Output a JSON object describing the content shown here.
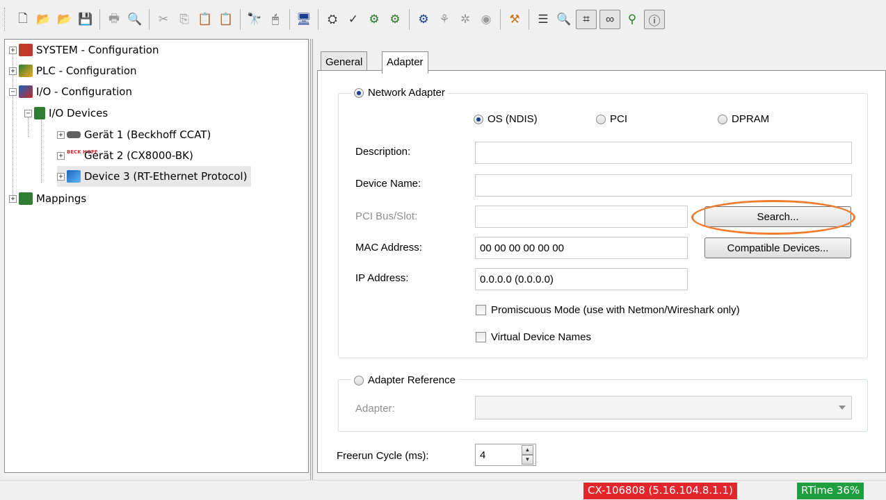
{
  "toolbar": {
    "buttons": [
      "new-file",
      "open-file",
      "open-project",
      "save",
      "print",
      "print-preview",
      "cut",
      "copy",
      "paste",
      "paste-with-links",
      "find",
      "mouse",
      "screen",
      "activate-config",
      "check-config",
      "build",
      "run-mode",
      "config-mode",
      "scan",
      "watch",
      "target",
      "toggle-free-run",
      "find-small",
      "zoom",
      "show-online",
      "toggle-monitoring",
      "network"
    ],
    "colors": {
      "blue": "#1a3d8f",
      "green": "#2a7a2a",
      "gray": "#9a9a9a"
    }
  },
  "tree": {
    "items": [
      {
        "label": "SYSTEM - Configuration",
        "icon": "system-config-icon",
        "color": "#c0392b"
      },
      {
        "label": "PLC - Configuration",
        "icon": "plc-config-icon",
        "color": "#2e7d32"
      },
      {
        "label": "I/O - Configuration",
        "icon": "io-config-icon",
        "color": "#1565c0"
      },
      {
        "label": "I/O Devices",
        "icon": "io-devices-icon",
        "color": "#2e7d32"
      },
      {
        "label": "Gerät 1 (Beckhoff CCAT)",
        "icon": "ccat-card-icon",
        "color": "#555555"
      },
      {
        "label": "Gerät 2 (CX8000-BK)",
        "icon": "beckhoff-logo-icon",
        "color": "#d32f2f",
        "icon_text": "BECK HOFF"
      },
      {
        "label": "Device 3 (RT-Ethernet Protocol)",
        "icon": "network-device-icon",
        "color": "#1565c0"
      },
      {
        "label": "Mappings",
        "icon": "mappings-icon",
        "color": "#2e7d32"
      }
    ]
  },
  "tabs": [
    {
      "label": "General",
      "active": false
    },
    {
      "label": "Adapter",
      "active": true
    }
  ],
  "adapter": {
    "network_adapter_label": "Network Adapter",
    "network_adapter_selected": true,
    "mode_options": [
      {
        "label": "OS (NDIS)",
        "selected": true
      },
      {
        "label": "PCI",
        "selected": false
      },
      {
        "label": "DPRAM",
        "selected": false
      }
    ],
    "description_label": "Description:",
    "description_value": "",
    "device_name_label": "Device Name:",
    "device_name_value": "",
    "pci_bus_label": "PCI Bus/Slot:",
    "pci_bus_value": "",
    "search_button": "Search...",
    "mac_label": "MAC Address:",
    "mac_value": "00 00 00 00 00 00",
    "compatible_button": "Compatible Devices...",
    "ip_label": "IP Address:",
    "ip_value": "0.0.0.0 (0.0.0.0)",
    "promiscuous_label": "Promiscuous Mode (use with Netmon/Wireshark only)",
    "promiscuous_checked": false,
    "virtual_names_label": "Virtual Device Names",
    "virtual_names_checked": false,
    "adapter_reference_label": "Adapter Reference",
    "adapter_reference_selected": false,
    "adapter_label": "Adapter:",
    "adapter_value": "",
    "freerun_label": "Freerun Cycle (ms):",
    "freerun_value": "4",
    "highlight_color": "#f07d2e"
  },
  "status": {
    "target": "CX-106808 (5.16.104.8.1.1)",
    "target_color": "#e3262b",
    "rtime": "RTime 36%",
    "rtime_color": "#1e9e3e"
  }
}
